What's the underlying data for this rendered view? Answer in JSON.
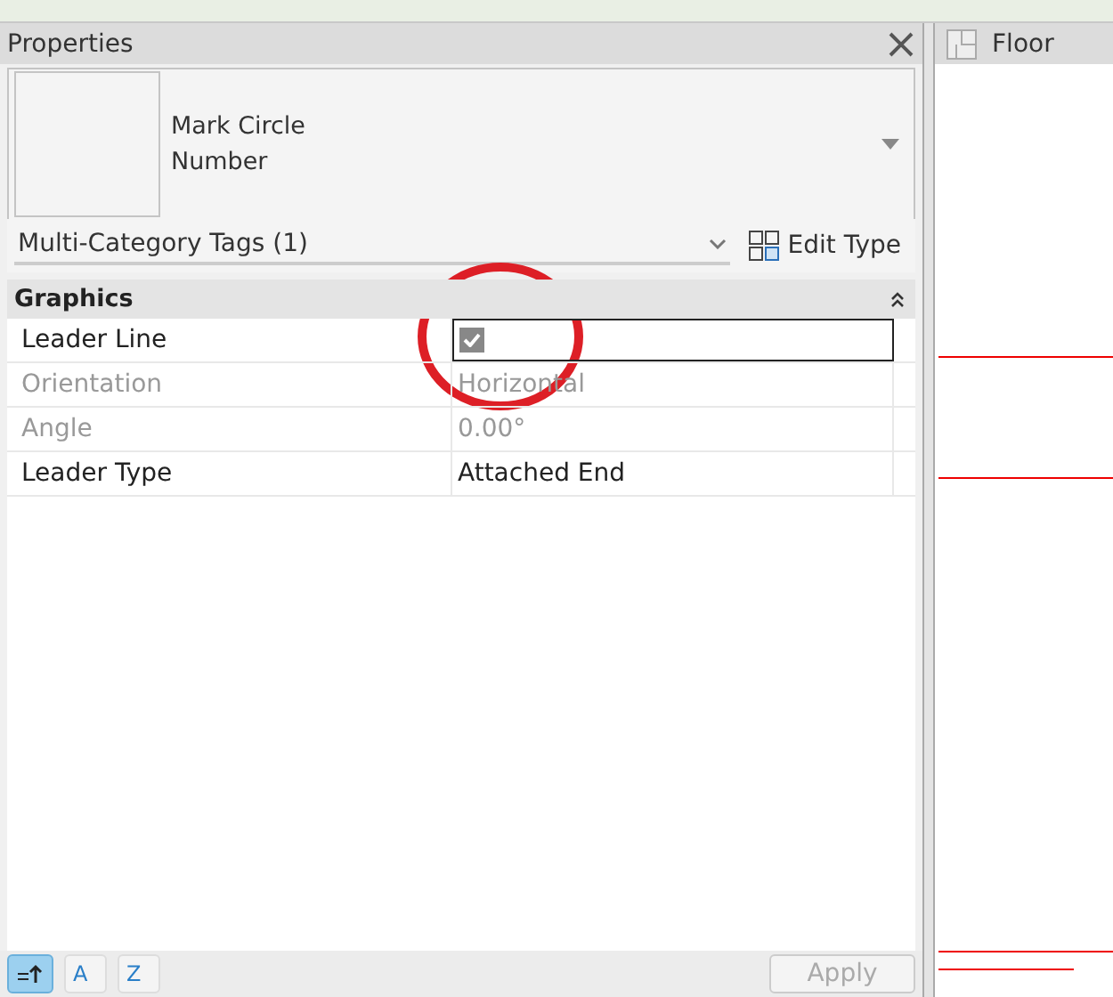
{
  "panel": {
    "title": "Properties",
    "type_name": "Mark Circle\nNumber",
    "instance": "Multi-Category Tags (1)",
    "edit_type": "Edit Type"
  },
  "groups": [
    {
      "title": "Graphics",
      "expanded": true,
      "rows": [
        {
          "label": "Leader Line",
          "kind": "checkbox",
          "checked": true,
          "disabled": false
        },
        {
          "label": "Orientation",
          "kind": "text",
          "value": "Horizontal",
          "disabled": true
        },
        {
          "label": "Angle",
          "kind": "text",
          "value": "0.00°",
          "disabled": true
        },
        {
          "label": "Leader Type",
          "kind": "text",
          "value": "Attached End",
          "disabled": false
        }
      ]
    }
  ],
  "footer": {
    "sort_buttons": [
      {
        "label": "A",
        "selected": false
      },
      {
        "label": "Z",
        "selected": false
      }
    ],
    "apply": "Apply"
  },
  "view": {
    "title": "Floor"
  }
}
